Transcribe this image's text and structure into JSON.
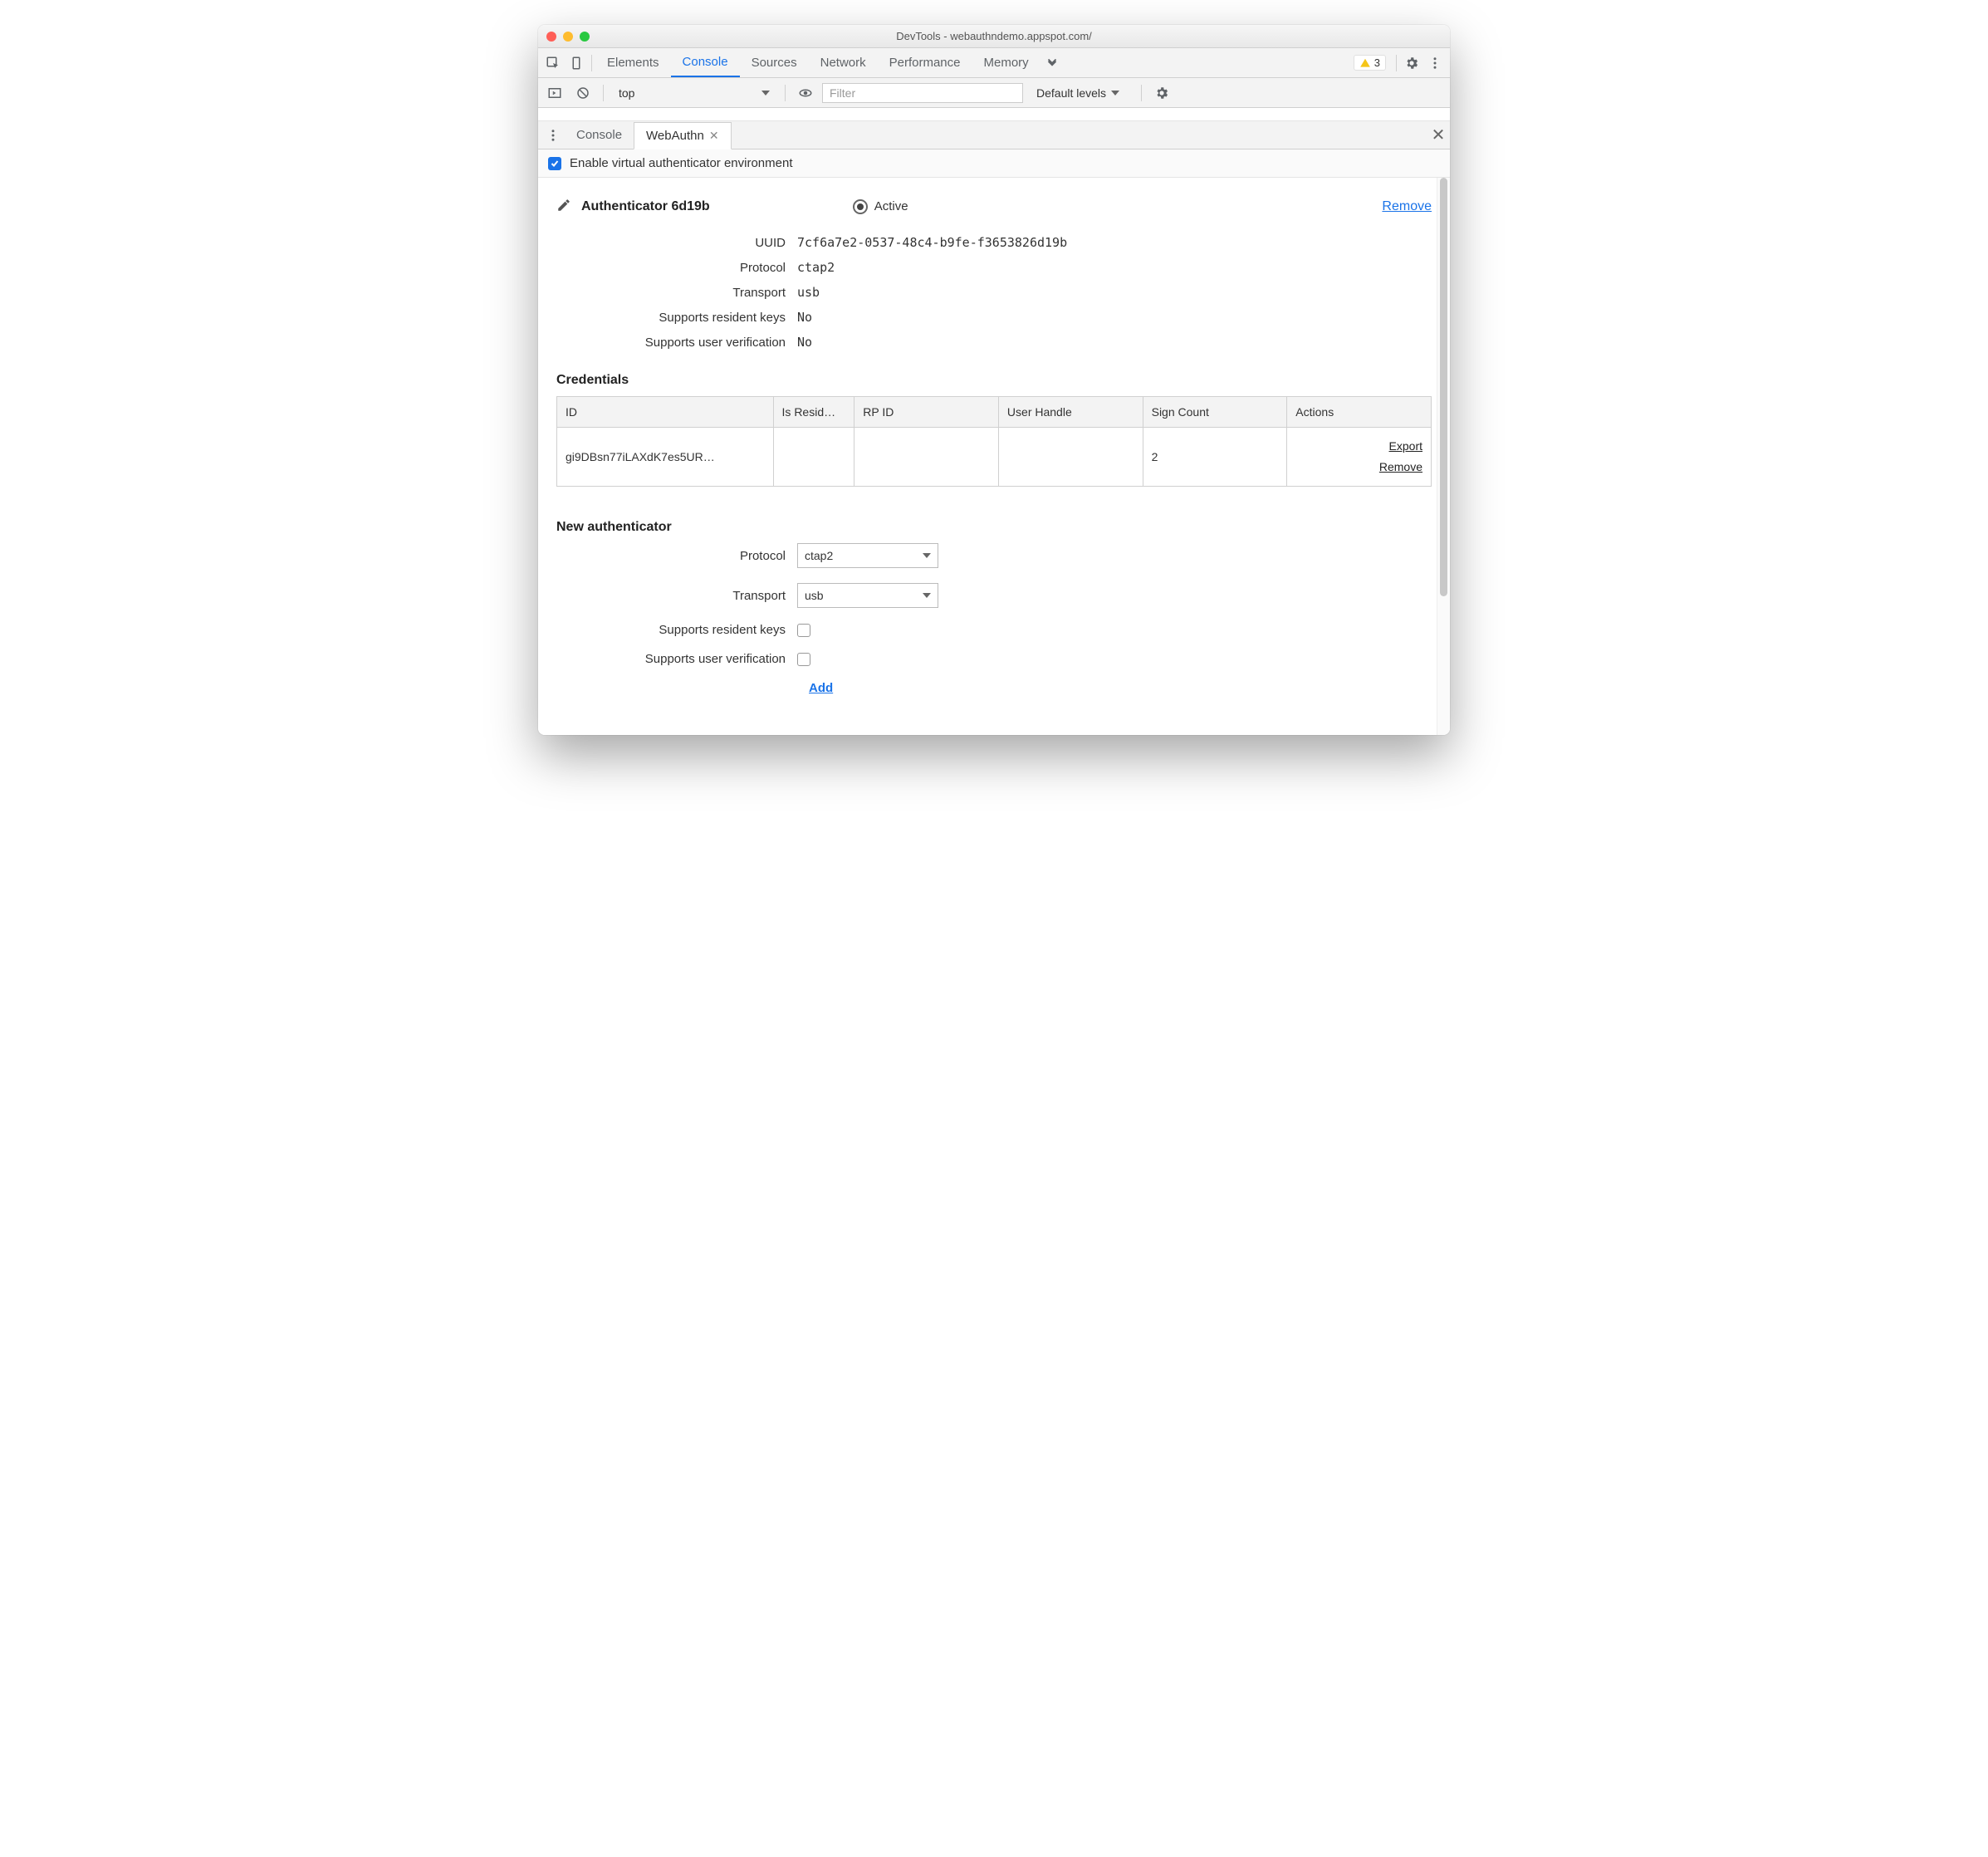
{
  "window": {
    "title": "DevTools - webauthndemo.appspot.com/"
  },
  "main_tabs": {
    "t0": "Elements",
    "t1": "Console",
    "t2": "Sources",
    "t3": "Network",
    "t4": "Performance",
    "t5": "Memory"
  },
  "warning_count": "3",
  "console_bar": {
    "context": "top",
    "filter_placeholder": "Filter",
    "levels": "Default levels"
  },
  "drawer_tabs": {
    "t0": "Console",
    "t1": "WebAuthn"
  },
  "enable_label": "Enable virtual authenticator environment",
  "authenticator": {
    "title": "Authenticator 6d19b",
    "active_label": "Active",
    "remove_label": "Remove",
    "fields": {
      "uuid_label": "UUID",
      "uuid": "7cf6a7e2-0537-48c4-b9fe-f3653826d19b",
      "protocol_label": "Protocol",
      "protocol": "ctap2",
      "transport_label": "Transport",
      "transport": "usb",
      "rk_label": "Supports resident keys",
      "rk": "No",
      "uv_label": "Supports user verification",
      "uv": "No"
    }
  },
  "credentials": {
    "title": "Credentials",
    "headers": {
      "id": "ID",
      "resident": "Is Resid…",
      "rp": "RP ID",
      "uh": "User Handle",
      "sc": "Sign Count",
      "actions": "Actions"
    },
    "row": {
      "id": "gi9DBsn77iLAXdK7es5UR…",
      "resident": "",
      "rp": "",
      "uh": "",
      "sc": "2",
      "export": "Export",
      "remove": "Remove"
    }
  },
  "new_auth": {
    "title": "New authenticator",
    "protocol_label": "Protocol",
    "protocol_value": "ctap2",
    "transport_label": "Transport",
    "transport_value": "usb",
    "rk_label": "Supports resident keys",
    "uv_label": "Supports user verification",
    "add_label": "Add"
  }
}
